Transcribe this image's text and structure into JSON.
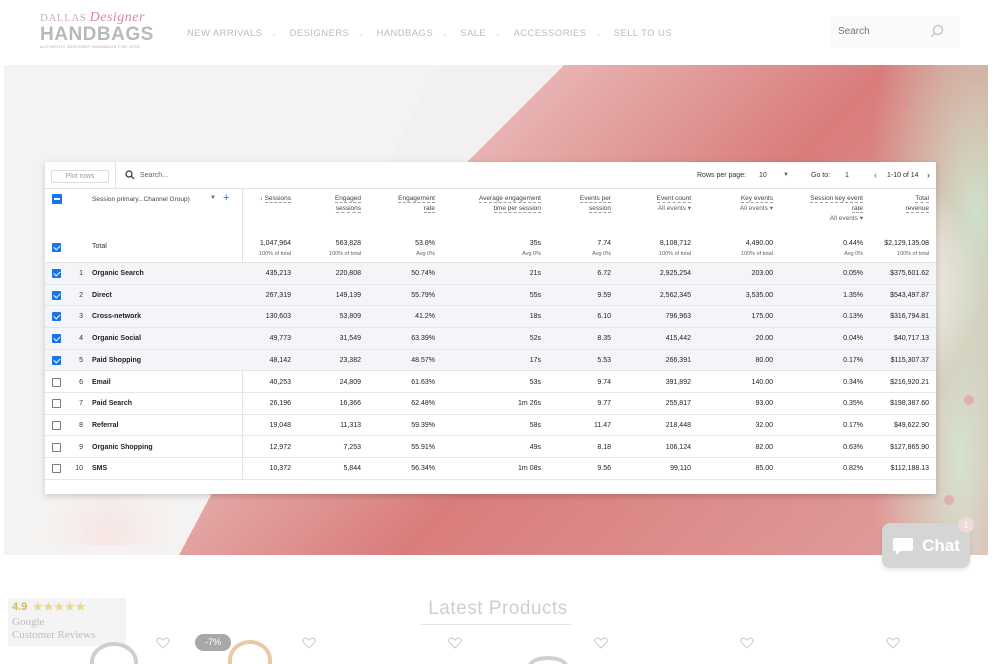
{
  "header": {
    "logo": {
      "line1a": "DALLAS",
      "line1b": "Designer",
      "line2": "HANDBAGS",
      "line3": "AUTHENTIC DESIGNER HANDBAGS FOR LESS"
    },
    "nav": [
      {
        "label": "NEW ARRIVALS",
        "has_dropdown": true
      },
      {
        "label": "DESIGNERS",
        "has_dropdown": true
      },
      {
        "label": "HANDBAGS",
        "has_dropdown": true
      },
      {
        "label": "SALE",
        "has_dropdown": true
      },
      {
        "label": "ACCESSORIES",
        "has_dropdown": true
      },
      {
        "label": "SELL TO US",
        "has_dropdown": false
      }
    ],
    "search_placeholder": "Search"
  },
  "analytics": {
    "toolbar": {
      "plot_rows": "Plot rows",
      "search": "Search...",
      "rows_per_page_label": "Rows per page:",
      "rows_per_page_value": "10",
      "goto_label": "Go to:",
      "goto_value": "1",
      "range": "1-10 of 14"
    },
    "dimension_header": "Session primary...Channel Group)",
    "columns": [
      {
        "l1": "Sessions",
        "l2": "",
        "l3": "",
        "sort": true
      },
      {
        "l1": "Engaged",
        "l2": "sessions",
        "l3": ""
      },
      {
        "l1": "Engagement",
        "l2": "rate",
        "l3": ""
      },
      {
        "l1": "Average engagement",
        "l2": "time per session",
        "l3": ""
      },
      {
        "l1": "Events per",
        "l2": "session",
        "l3": ""
      },
      {
        "l1": "Event count",
        "l2": "All events",
        "l3": ""
      },
      {
        "l1": "Key events",
        "l2": "All events",
        "l3": ""
      },
      {
        "l1": "Session key event",
        "l2": "rate",
        "l3": "All events"
      },
      {
        "l1": "Total",
        "l2": "revenue",
        "l3": ""
      }
    ],
    "total": {
      "label": "Total",
      "values": [
        "1,047,964",
        "563,828",
        "53.8%",
        "35s",
        "7.74",
        "8,108,712",
        "4,490.00",
        "0.44%",
        "$2,129,135.08"
      ],
      "subs": [
        "100% of total",
        "100% of total",
        "Avg 0%",
        "Avg 0%",
        "Avg 0%",
        "100% of total",
        "100% of total",
        "Avg 0%",
        "100% of total"
      ]
    },
    "rows": [
      {
        "idx": "1",
        "name": "Organic Search",
        "checked": true,
        "values": [
          "435,213",
          "220,808",
          "50.74%",
          "21s",
          "6.72",
          "2,925,254",
          "203.00",
          "0.05%",
          "$375,601.62"
        ]
      },
      {
        "idx": "2",
        "name": "Direct",
        "checked": true,
        "values": [
          "267,319",
          "149,139",
          "55.79%",
          "55s",
          "9.59",
          "2,562,345",
          "3,535.00",
          "1.35%",
          "$543,497.87"
        ]
      },
      {
        "idx": "3",
        "name": "Cross-network",
        "checked": true,
        "values": [
          "130,603",
          "53,809",
          "41.2%",
          "18s",
          "6.10",
          "796,963",
          "175.00",
          "0.13%",
          "$316,794.81"
        ]
      },
      {
        "idx": "4",
        "name": "Organic Social",
        "checked": true,
        "values": [
          "49,773",
          "31,549",
          "63.39%",
          "52s",
          "8.35",
          "415,442",
          "20.00",
          "0.04%",
          "$40,717.13"
        ]
      },
      {
        "idx": "5",
        "name": "Paid Shopping",
        "checked": true,
        "values": [
          "48,142",
          "23,382",
          "48.57%",
          "17s",
          "5.53",
          "266,391",
          "80.00",
          "0.17%",
          "$115,307.37"
        ]
      },
      {
        "idx": "6",
        "name": "Email",
        "checked": false,
        "values": [
          "40,253",
          "24,809",
          "61.63%",
          "53s",
          "9.74",
          "391,892",
          "140.00",
          "0.34%",
          "$216,920.21"
        ]
      },
      {
        "idx": "7",
        "name": "Paid Search",
        "checked": false,
        "values": [
          "26,196",
          "16,366",
          "62.48%",
          "1m 26s",
          "9.77",
          "255,817",
          "93.00",
          "0.35%",
          "$198,387.60"
        ]
      },
      {
        "idx": "8",
        "name": "Referral",
        "checked": false,
        "values": [
          "19,048",
          "11,313",
          "59.39%",
          "58s",
          "11.47",
          "218,448",
          "32.00",
          "0.17%",
          "$49,622.90"
        ]
      },
      {
        "idx": "9",
        "name": "Organic Shopping",
        "checked": false,
        "values": [
          "12,972",
          "7,253",
          "55.91%",
          "49s",
          "8.18",
          "106,124",
          "82.00",
          "0.63%",
          "$127,865.90"
        ]
      },
      {
        "idx": "10",
        "name": "SMS",
        "checked": false,
        "values": [
          "10,372",
          "5,844",
          "56.34%",
          "1m 08s",
          "9.56",
          "99,110",
          "85.00",
          "0.82%",
          "$112,188.13"
        ]
      }
    ]
  },
  "chat": {
    "label": "Chat",
    "badge": "1"
  },
  "reviews": {
    "score": "4.9",
    "stars": "★★★★★",
    "source": "Google",
    "label": "Customer Reviews"
  },
  "latest": {
    "title": "Latest Products",
    "discount_badge": "-7%"
  }
}
